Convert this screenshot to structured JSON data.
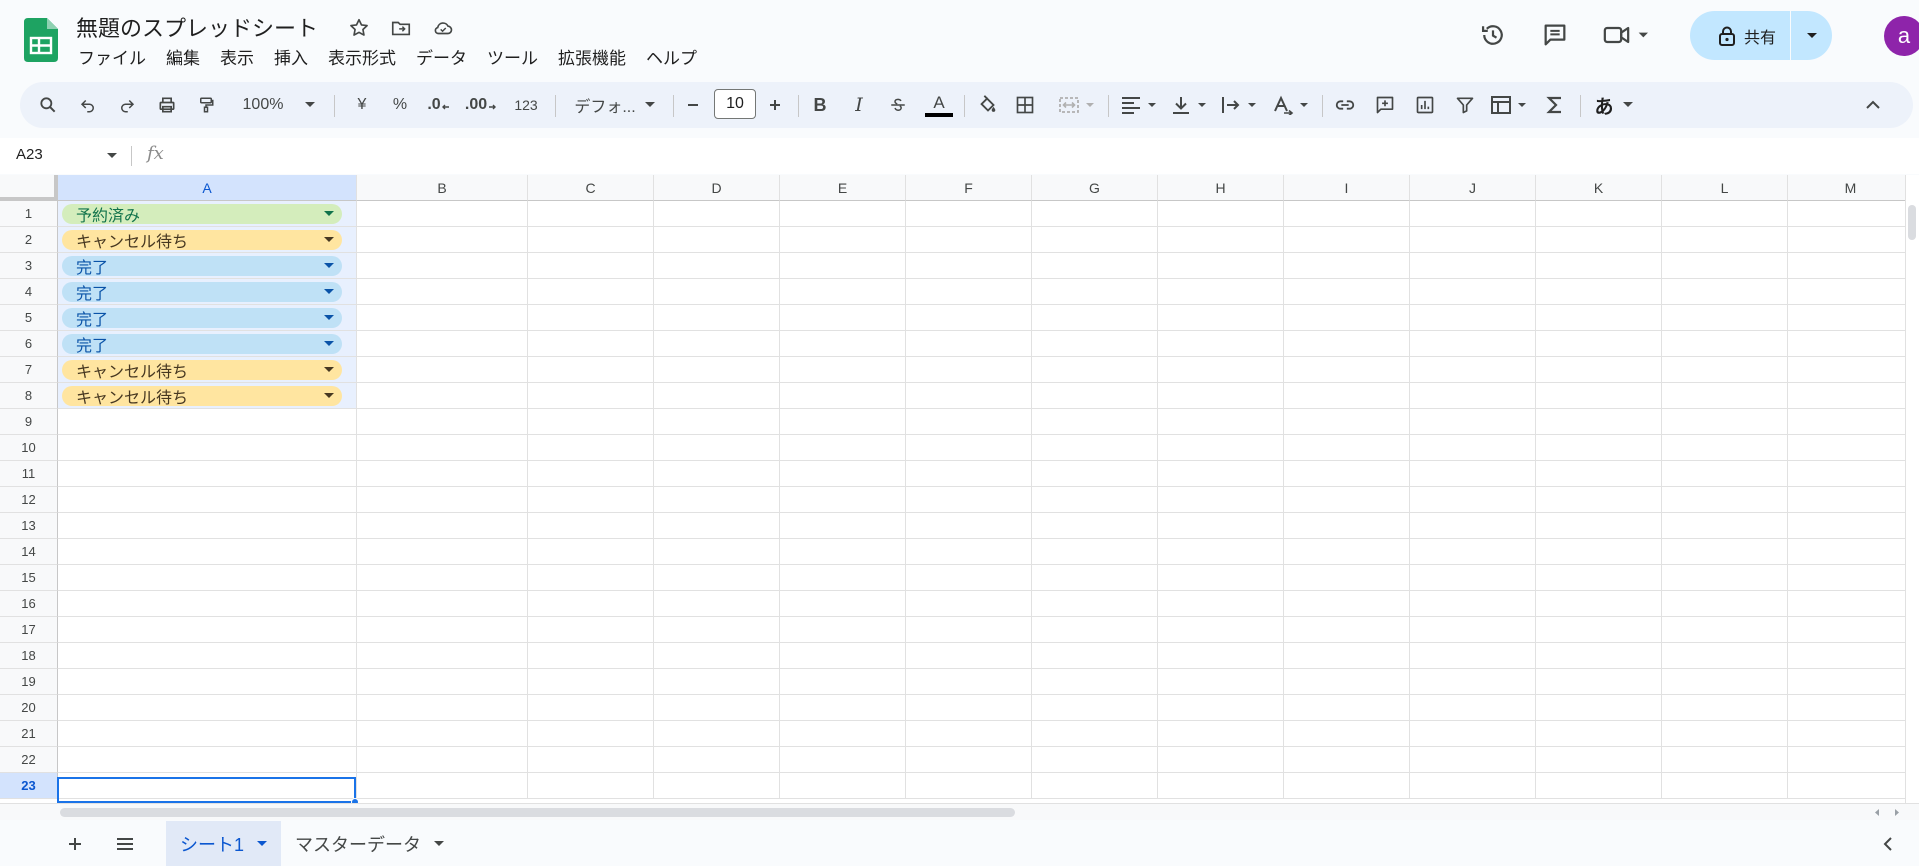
{
  "header": {
    "title": "無題のスプレッドシート",
    "menu": [
      "ファイル",
      "編集",
      "表示",
      "挿入",
      "表示形式",
      "データ",
      "ツール",
      "拡張機能",
      "ヘルプ"
    ],
    "share_label": "共有",
    "avatar_letter": "a"
  },
  "toolbar": {
    "zoom": "100%",
    "currency": "¥",
    "percent": "%",
    "decrease_decimal": ".0",
    "increase_decimal": ".00",
    "number_format": "123",
    "font": "デフォ...",
    "font_size": "10",
    "bold": "B",
    "italic": "I",
    "text_color": "A",
    "input_tools": "あ"
  },
  "formula_bar": {
    "name_box": "A23",
    "fx": "fx",
    "value": ""
  },
  "grid": {
    "columns": [
      "A",
      "B",
      "C",
      "D",
      "E",
      "F",
      "G",
      "H",
      "I",
      "J",
      "K",
      "L",
      "M"
    ],
    "rows": [
      "1",
      "2",
      "3",
      "4",
      "5",
      "6",
      "7",
      "8",
      "9",
      "10",
      "11",
      "12",
      "13",
      "14",
      "15",
      "16",
      "17",
      "18",
      "19",
      "20",
      "21",
      "22",
      "23"
    ],
    "selected_row": "23",
    "column_a_values": [
      "予約済み",
      "キャンセル待ち",
      "完了",
      "完了",
      "完了",
      "完了",
      "キャンセル待ち",
      "キャンセル待ち"
    ]
  },
  "status_colors": {
    "予約済み": {
      "bg": "#d4edbc",
      "fg": "#11734b",
      "arrow": "#11734b"
    },
    "キャンセル待ち": {
      "bg": "#ffe5a0",
      "fg": "#473821",
      "arrow": "#473821"
    },
    "完了": {
      "bg": "#bfe1f6",
      "fg": "#0a53a8",
      "arrow": "#0a53a8"
    }
  },
  "sheets": [
    {
      "label": "シート1",
      "active": true
    },
    {
      "label": "マスターデータ",
      "active": false
    }
  ]
}
